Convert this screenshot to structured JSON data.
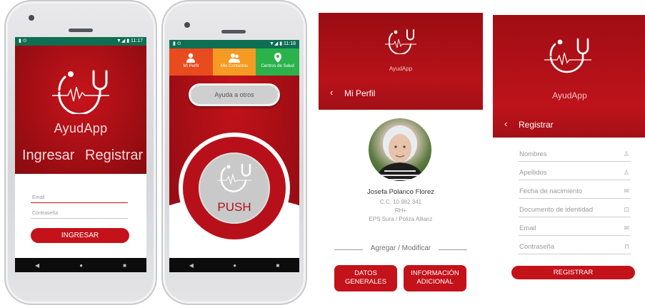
{
  "app_name": "AyudApp",
  "screen_login": {
    "status_time": "11:17",
    "tabs": [
      "Ingresar",
      "Registrar"
    ],
    "email_label": "Email",
    "password_label": "Contraseña",
    "submit_label": "INGRESAR",
    "nav": [
      "◀",
      "●",
      "■"
    ]
  },
  "screen_home": {
    "status_time": "11:18",
    "tabs": [
      {
        "label": "Mi Perfil",
        "color": "#e84b1e",
        "icon": "user-icon"
      },
      {
        "label": "Mis Contactos",
        "color": "#f59a22",
        "icon": "contacts-icon"
      },
      {
        "label": "Centros de Salud",
        "color": "#2bb24b",
        "icon": "location-pin-icon"
      }
    ],
    "help_label": "Ayuda a otros",
    "push_label": "PUSH",
    "nav": [
      "◀",
      "●",
      "■"
    ]
  },
  "screen_profile": {
    "back": "‹",
    "title": "Mi Perfil",
    "name": "Josefa Polanco Florez",
    "id_line": "C.C. 10.982.341",
    "blood": "RH+",
    "insurance": "EPS Sura / Póliza Allianz",
    "section_label": "Agregar / Modificar",
    "buttons": [
      {
        "line1": "DATOS",
        "line2": "GENERALES"
      },
      {
        "line1": "INFORMACIÓN",
        "line2": "ADICIONAL"
      }
    ]
  },
  "screen_register": {
    "back": "‹",
    "title": "Registrar",
    "fields": [
      {
        "label": "Nombres",
        "icon": "user-icon"
      },
      {
        "label": "Apellidos",
        "icon": "user-icon"
      },
      {
        "label": "Fecha de nacimiento",
        "icon": "calendar-icon"
      },
      {
        "label": "Documento de identidad",
        "icon": "id-card-icon"
      },
      {
        "label": "Email",
        "icon": "mail-icon"
      },
      {
        "label": "Contraseña",
        "icon": "lock-icon"
      }
    ],
    "submit_label": "REGISTRAR"
  },
  "colors": {
    "brand_red": "#c4121a",
    "dark_red": "#880b10",
    "status_green": "#0f6f52"
  }
}
